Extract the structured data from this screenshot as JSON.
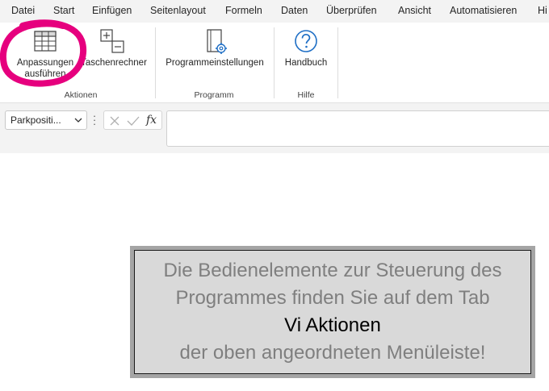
{
  "menu": {
    "items": [
      "Datei",
      "Start",
      "Einfügen",
      "Seitenlayout",
      "Formeln",
      "Daten",
      "Überprüfen",
      "Ansicht",
      "Automatisieren",
      "Hi"
    ]
  },
  "ribbon": {
    "buttons": {
      "anpassungen_line1": "Anpassungen",
      "anpassungen_line2": "ausführen",
      "taschenrechner": "Taschenrechner",
      "programmeinstellungen": "Programmeinstellungen",
      "handbuch": "Handbuch"
    },
    "groups": {
      "aktionen": "Aktionen",
      "programm": "Programm",
      "hilfe": "Hilfe"
    }
  },
  "formula_bar": {
    "name_box": "Parkpositi...",
    "fx_label": "fx",
    "formula_value": ""
  },
  "message": {
    "line1": "Die Bedienelemente zur Steuerung des",
    "line2": "Programmes finden Sie auf dem Tab",
    "line3": "Vi Aktionen",
    "line4": "der oben angeordneten Menüleiste!"
  },
  "colors": {
    "highlight": "#e6007e",
    "ribbon_bg": "#f3f3f3",
    "message_text": "#7f7f7f",
    "message_bg": "#d9d9d9",
    "help_icon": "#1f6fc5"
  }
}
